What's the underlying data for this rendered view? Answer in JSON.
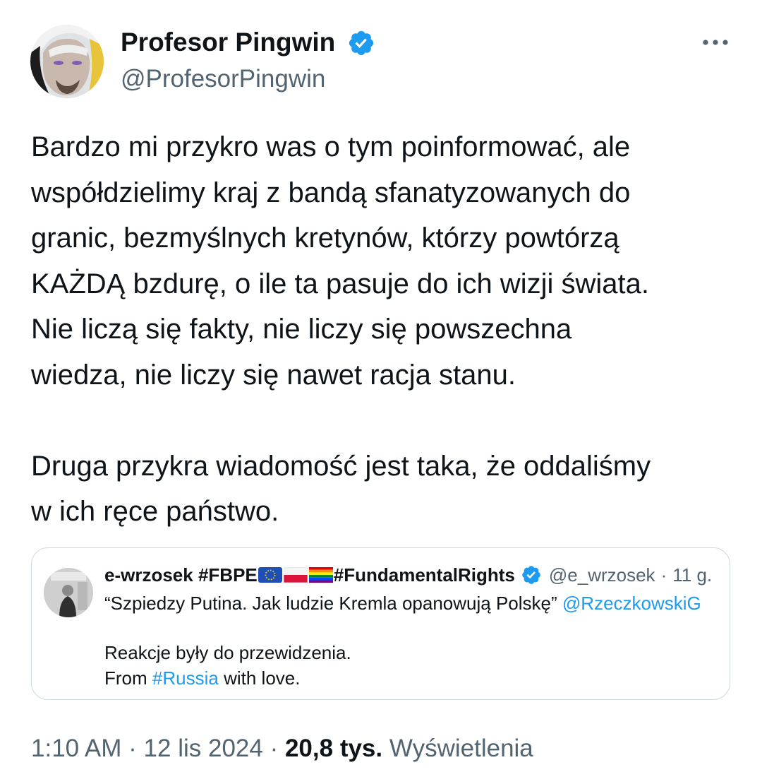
{
  "author": {
    "display_name": "Profesor Pingwin",
    "handle": "@ProfesorPingwin",
    "verified_icon": "verified-badge-icon"
  },
  "menu_icon": "more-horizontal-icon",
  "tweet": {
    "lines": [
      "Bardzo mi przykro was o tym poinformować, ale",
      "współdzielimy kraj z bandą sfanatyzowanych do",
      "granic, bezmyślnych kretynów, którzy powtórzą",
      "KAŻDĄ bzdurę, o ile ta pasuje do ich wizji świata.",
      "Nie liczą się fakty, nie liczy się powszechna",
      "wiedza, nie liczy się nawet racja stanu."
    ],
    "lines2": [
      "Druga przykra wiadomość jest taka, że oddaliśmy",
      "w ich ręce państwo."
    ]
  },
  "quoted": {
    "name_part1": "e-wrzosek #FBPE",
    "name_part2": "#FundamentalRights",
    "flags": [
      "eu-flag",
      "poland-flag",
      "rainbow-flag"
    ],
    "handle": "@e_wrzosek",
    "separator": "·",
    "time": "11 g.",
    "line1_text": "“Szpiedzy Putina. Jak ludzie Kremla opanowują Polskę”",
    "line1_mention": "@RzeczkowskiG",
    "line2": "Reakcje były do przewidzenia.",
    "line3_prefix": "From",
    "line3_hashtag": "#Russia",
    "line3_suffix": "with love."
  },
  "meta": {
    "time": "1:10 AM",
    "sep1": "·",
    "date": "12 lis 2024",
    "sep2": "·",
    "views_count": "20,8 tys.",
    "views_label": "Wyświetlenia"
  },
  "colors": {
    "text": "#0f1419",
    "secondary": "#536471",
    "link": "#1d9bf0",
    "verified": "#1d9bf0",
    "border": "#cfd9de"
  }
}
